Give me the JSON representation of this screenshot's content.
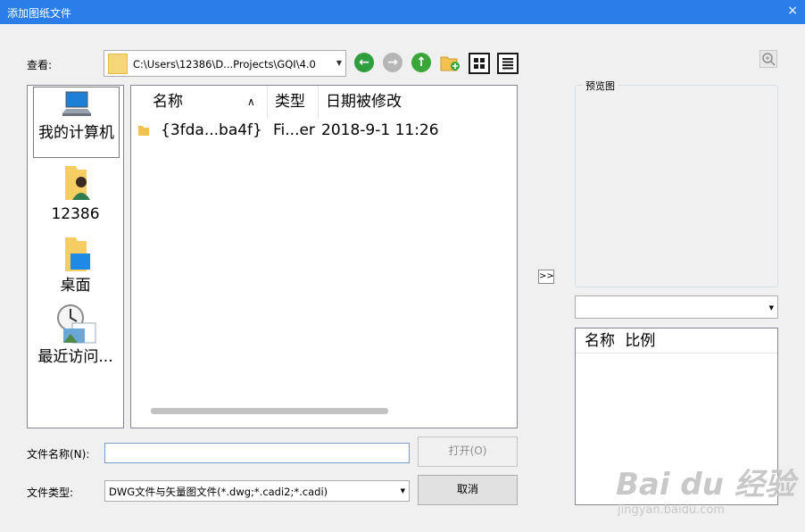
{
  "window": {
    "title": "添加图纸文件",
    "close_icon": "×"
  },
  "toolbar": {
    "look_in_label": "查看:",
    "path": "C:\\Users\\12386\\D...Projects\\GQI\\4.0",
    "back_color": "#2e9e3e",
    "forward_color": "#b5b5b5",
    "up_color": "#3aa63a"
  },
  "places": [
    {
      "label": "我的计算机",
      "icon": "computer-icon",
      "selected": true
    },
    {
      "label": "12386",
      "icon": "user-folder-icon",
      "selected": false
    },
    {
      "label": "桌面",
      "icon": "desktop-folder-icon",
      "selected": false
    },
    {
      "label": "最近访问...",
      "icon": "recent-icon",
      "selected": false
    }
  ],
  "filelist": {
    "columns": [
      "名称",
      "类型",
      "日期被修改"
    ],
    "rows": [
      {
        "name": "{3fda...ba4f}",
        "type": "Fi...er",
        "modified": "2018-9-1 11:26"
      }
    ]
  },
  "form": {
    "filename_label": "文件名称(N):",
    "filename_value": "",
    "filetype_label": "文件类型:",
    "filetype_value": "DWG文件与矢量图文件(*.dwg;*.cadi2;*.cadi)",
    "open_label": "打开(O)",
    "cancel_label": "取消"
  },
  "preview": {
    "group_label": "预览图",
    "expand_label": ">>",
    "combo_value": "",
    "list_columns": [
      "名称",
      "比例"
    ]
  },
  "watermark": {
    "text": "Bai du 经验",
    "url": "jingyan.baidu.com"
  }
}
